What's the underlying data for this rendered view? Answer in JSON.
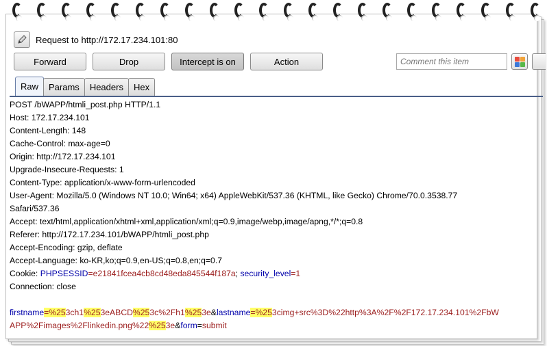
{
  "title": "Request to http://172.17.234.101:80",
  "buttons": {
    "forward": "Forward",
    "drop": "Drop",
    "intercept": "Intercept is on",
    "action": "Action"
  },
  "comment_placeholder": "Comment this item",
  "tabs": [
    "Raw",
    "Params",
    "Headers",
    "Hex"
  ],
  "selected_tab": "Raw",
  "colors": {
    "param_name": "#0000aa",
    "param_value": "#9b1c1c",
    "highlight": "#ffff66",
    "tab_line": "#4a5f88",
    "color_picker": [
      "#e84b3c",
      "#f1a33a",
      "#3a78d8",
      "#58b84a"
    ]
  },
  "icons": {
    "edit": "pencil-icon",
    "highlight": "color-picker-icon"
  },
  "request": {
    "headers": [
      "POST /bWAPP/htmli_post.php HTTP/1.1",
      "Host: 172.17.234.101",
      "Content-Length: 148",
      "Cache-Control: max-age=0",
      "Origin: http://172.17.234.101",
      "Upgrade-Insecure-Requests: 1",
      "Content-Type: application/x-www-form-urlencoded",
      "User-Agent: Mozilla/5.0 (Windows NT 10.0; Win64; x64) AppleWebKit/537.36 (KHTML, like Gecko) Chrome/70.0.3538.77",
      "Safari/537.36",
      "Accept: text/html,application/xhtml+xml,application/xml;q=0.9,image/webp,image/apng,*/*;q=0.8",
      "Referer: http://172.17.234.101/bWAPP/htmli_post.php",
      "Accept-Encoding: gzip, deflate",
      "Accept-Language: ko-KR,ko;q=0.9,en-US;q=0.8,en;q=0.7"
    ],
    "cookie": {
      "label": "Cookie: ",
      "name1": "PHPSESSID",
      "eq1": "=",
      "value1": "e21841fcea4cb8cd48eda845544f187a",
      "sep": "; ",
      "name2": "security_level",
      "eq2": "=",
      "value2": "1"
    },
    "connection": "Connection: close",
    "body_line1": [
      {
        "t": "firstname",
        "c": "name"
      },
      {
        "t": "=",
        "c": "hl"
      },
      {
        "t": "%25",
        "c": "hlval"
      },
      {
        "t": "3ch1",
        "c": "val"
      },
      {
        "t": "%25",
        "c": "hlval"
      },
      {
        "t": "3eABCD",
        "c": "val"
      },
      {
        "t": "%25",
        "c": "hlval"
      },
      {
        "t": "3c%2Fh1",
        "c": "val"
      },
      {
        "t": "%25",
        "c": "hlval"
      },
      {
        "t": "3e",
        "c": "val"
      },
      {
        "t": "&",
        "c": "amp"
      },
      {
        "t": "lastname",
        "c": "name"
      },
      {
        "t": "=",
        "c": "hl"
      },
      {
        "t": "%25",
        "c": "hlval"
      },
      {
        "t": "3cimg+src%3D%22http%3A%2F%2F172.17.234.101%2FbW",
        "c": "val"
      }
    ],
    "body_line2": [
      {
        "t": "APP%2Fimages%2Flinkedin.png%22",
        "c": "val"
      },
      {
        "t": "%25",
        "c": "hlval"
      },
      {
        "t": "3e",
        "c": "val"
      },
      {
        "t": "&",
        "c": "amp"
      },
      {
        "t": "form",
        "c": "name"
      },
      {
        "t": "=",
        "c": "amp"
      },
      {
        "t": "submit",
        "c": "val"
      }
    ]
  }
}
